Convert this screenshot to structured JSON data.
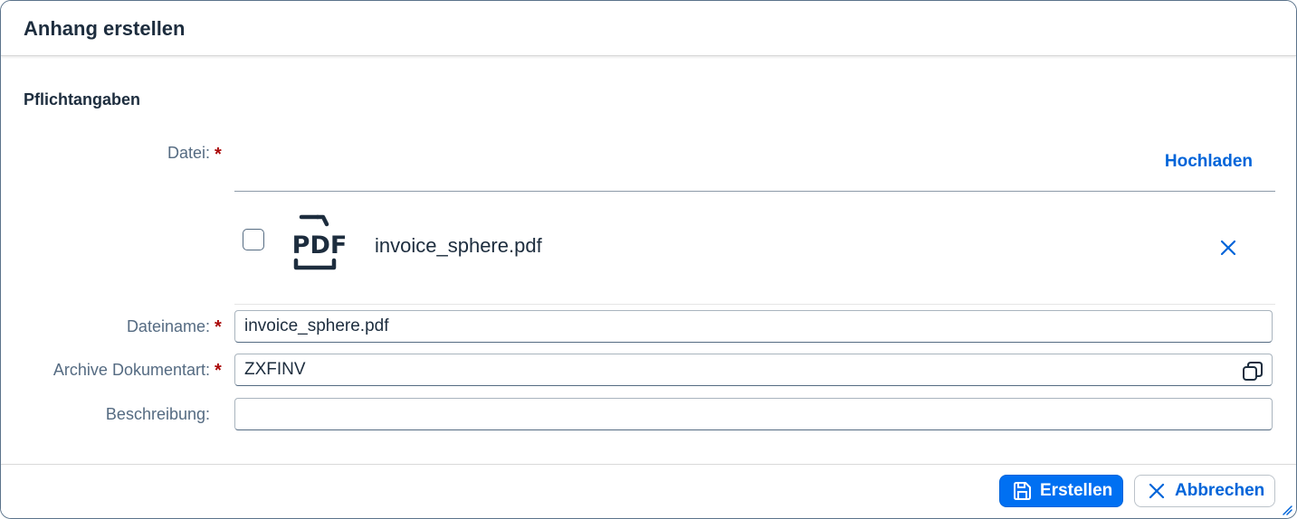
{
  "dialog": {
    "title": "Anhang erstellen"
  },
  "section": {
    "title": "Pflichtangaben"
  },
  "fields": {
    "file": {
      "label": "Datei:",
      "required_mark": "*",
      "upload_label": "Hochladen",
      "item": {
        "file_type": "PDF",
        "file_name": "invoice_sphere.pdf",
        "icon": "pdf-icon",
        "remove_icon": "close-icon"
      }
    },
    "filename": {
      "label": "Dateiname:",
      "required_mark": "*",
      "value": "invoice_sphere.pdf"
    },
    "doctype": {
      "label": "Archive Dokumentart:",
      "required_mark": "*",
      "value": "ZXFINV",
      "icon": "value-help-icon"
    },
    "description": {
      "label": "Beschreibung:",
      "value": ""
    }
  },
  "footer": {
    "create_label": "Erstellen",
    "create_icon": "save-icon",
    "cancel_label": "Abbrechen",
    "cancel_icon": "close-icon"
  },
  "colors": {
    "primary": "#0070f2",
    "link": "#0064d9",
    "required": "#aa0808",
    "label": "#556b82",
    "text": "#1d2d3e"
  }
}
